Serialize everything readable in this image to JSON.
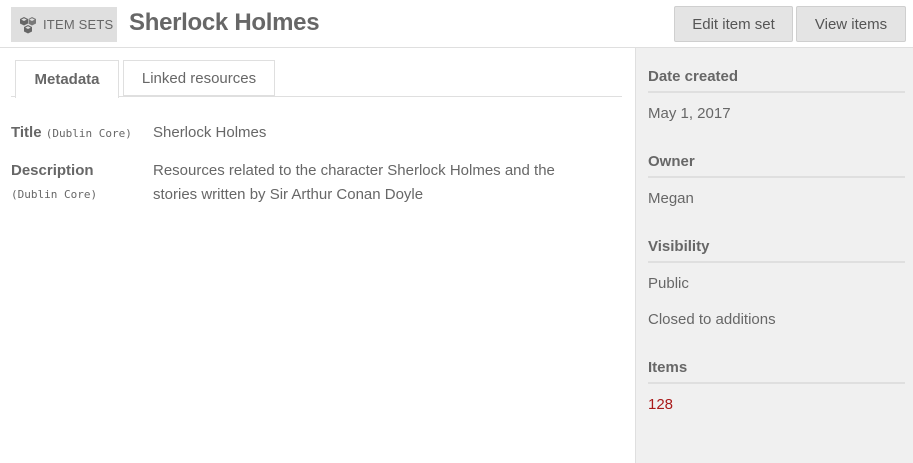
{
  "header": {
    "section_label": "ITEM SETS",
    "section_icon": "item-sets-icon",
    "title": "Sherlock Holmes",
    "edit_button": "Edit item set",
    "view_button": "View items"
  },
  "tabs": [
    {
      "label": "Metadata",
      "active": true
    },
    {
      "label": "Linked resources",
      "active": false
    }
  ],
  "properties": [
    {
      "label": "Title",
      "vocab": "(Dublin Core)",
      "value": "Sherlock Holmes"
    },
    {
      "label": "Description",
      "vocab": "(Dublin Core)",
      "value": "Resources related to the character Sherlock Holmes and the stories written by Sir Arthur Conan Doyle"
    }
  ],
  "sidebar": {
    "date_created_heading": "Date created",
    "date_created": "May 1, 2017",
    "owner_heading": "Owner",
    "owner": "Megan",
    "visibility_heading": "Visibility",
    "visibility": "Public",
    "additions": "Closed to additions",
    "items_heading": "Items",
    "items_count": "128"
  },
  "colors": {
    "accent_link": "#a91919",
    "text": "#676767",
    "sidebar_bg": "#f0f0f0"
  }
}
